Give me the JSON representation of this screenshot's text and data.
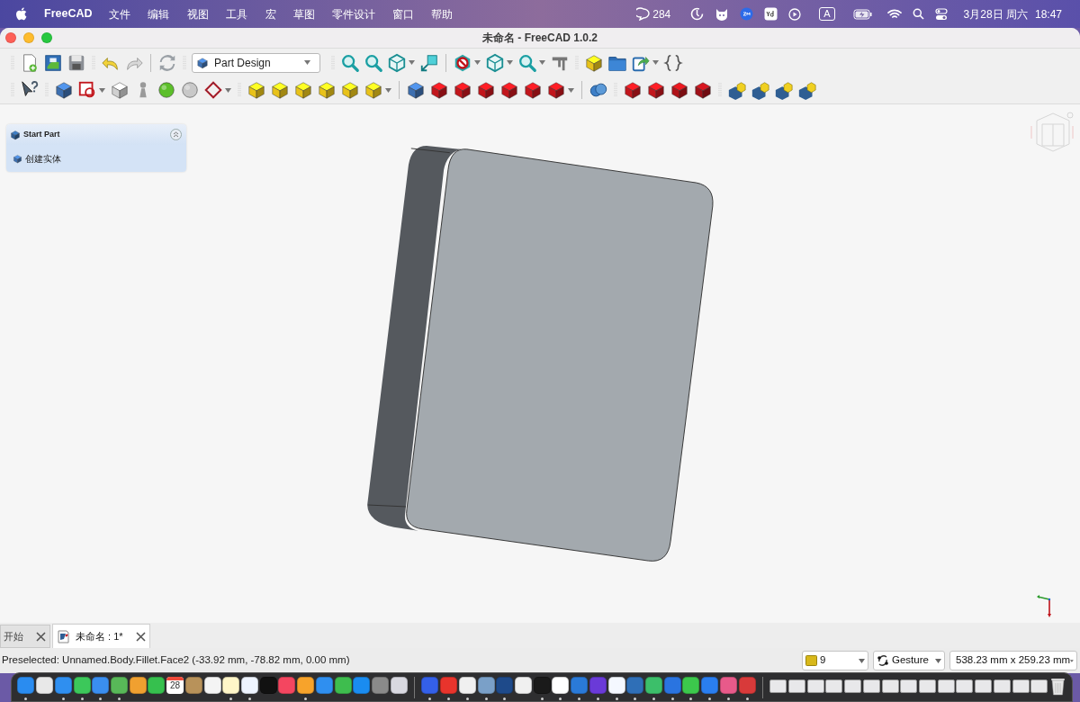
{
  "menu_bar": {
    "app_name": "FreeCAD",
    "menus": [
      "文件",
      "编辑",
      "视图",
      "工具",
      "宏",
      "草图",
      "零件设计",
      "窗口",
      "帮助"
    ],
    "notification_count": "284",
    "input_source": "A",
    "date": "3月28日 周六",
    "time": "18:47"
  },
  "window": {
    "title": "未命名 - FreeCAD 1.0.2"
  },
  "toolbar": {
    "workbench": "Part Design"
  },
  "task_panel": {
    "title": "Start Part",
    "expanded": true,
    "actions": [
      "创建实体"
    ]
  },
  "document_tabs": [
    {
      "label": "开始",
      "selected": false
    },
    {
      "label": "未命名 : 1*",
      "selected": true
    }
  ],
  "status_bar": {
    "message": "Preselected: Unnamed.Body.Fillet.Face2 (-33.92 mm, -78.82 mm, 0.00 mm)",
    "draw_style": "9",
    "navigation": "Gesture",
    "dimensions": "538.23 mm x 259.23 mm"
  },
  "dock": {
    "items": [
      {
        "kind": "app",
        "running": true
      },
      {
        "kind": "app",
        "running": false
      },
      {
        "kind": "app",
        "running": true
      },
      {
        "kind": "app",
        "running": true
      },
      {
        "kind": "app",
        "running": true
      },
      {
        "kind": "app",
        "running": true
      },
      {
        "kind": "app",
        "running": false
      },
      {
        "kind": "app",
        "running": false
      },
      {
        "kind": "calendar",
        "label": "28",
        "running": false
      },
      {
        "kind": "app",
        "running": false
      },
      {
        "kind": "app",
        "running": false
      },
      {
        "kind": "app",
        "running": true
      },
      {
        "kind": "app",
        "running": true
      },
      {
        "kind": "app",
        "running": false
      },
      {
        "kind": "app",
        "running": false
      },
      {
        "kind": "app",
        "running": true
      },
      {
        "kind": "app",
        "running": false
      },
      {
        "kind": "app",
        "running": false
      },
      {
        "kind": "app",
        "running": false
      },
      {
        "kind": "app",
        "running": false
      },
      {
        "kind": "app",
        "running": false
      },
      {
        "kind": "separator"
      },
      {
        "kind": "app",
        "running": true
      },
      {
        "kind": "app",
        "running": true
      },
      {
        "kind": "app",
        "running": true
      },
      {
        "kind": "app",
        "running": true
      },
      {
        "kind": "app",
        "running": true
      },
      {
        "kind": "app",
        "running": false
      },
      {
        "kind": "app",
        "running": true
      },
      {
        "kind": "app",
        "running": true
      },
      {
        "kind": "app",
        "running": true
      },
      {
        "kind": "app",
        "running": true
      },
      {
        "kind": "app",
        "running": true
      },
      {
        "kind": "app",
        "running": true
      },
      {
        "kind": "app",
        "running": true
      },
      {
        "kind": "app",
        "running": true
      },
      {
        "kind": "app",
        "running": true
      },
      {
        "kind": "app",
        "running": true
      },
      {
        "kind": "app",
        "running": true
      },
      {
        "kind": "app",
        "running": true
      },
      {
        "kind": "separator"
      },
      {
        "kind": "window"
      },
      {
        "kind": "window"
      },
      {
        "kind": "window"
      },
      {
        "kind": "window"
      },
      {
        "kind": "window"
      },
      {
        "kind": "window"
      },
      {
        "kind": "window"
      },
      {
        "kind": "window"
      },
      {
        "kind": "window"
      },
      {
        "kind": "window"
      },
      {
        "kind": "window"
      },
      {
        "kind": "window"
      },
      {
        "kind": "window"
      },
      {
        "kind": "window"
      },
      {
        "kind": "window"
      },
      {
        "kind": "trash"
      }
    ]
  }
}
